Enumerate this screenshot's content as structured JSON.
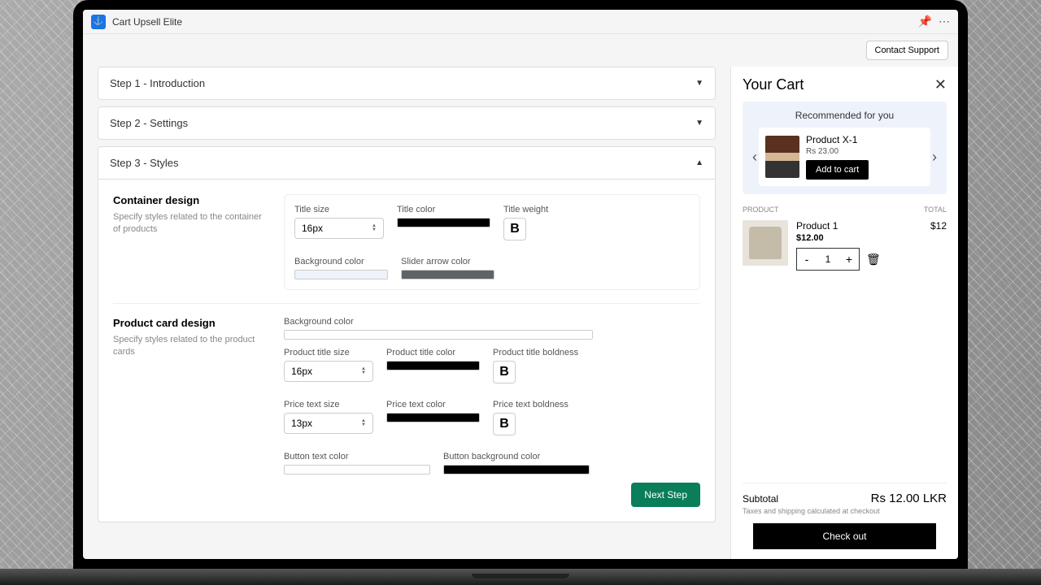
{
  "app": {
    "title": "Cart Upsell Elite"
  },
  "header": {
    "contact_support": "Contact Support"
  },
  "steps": {
    "step1": "Step 1 - Introduction",
    "step2": "Step 2 - Settings",
    "step3": "Step 3 - Styles"
  },
  "container_design": {
    "title": "Container design",
    "desc": "Specify styles related to the container of products",
    "title_size_label": "Title size",
    "title_size_value": "16px",
    "title_color_label": "Title color",
    "title_color": "#000000",
    "title_weight_label": "Title weight",
    "background_color_label": "Background color",
    "background_color": "#eef3fb",
    "slider_arrow_label": "Slider arrow color",
    "slider_arrow_color": "#5f6368"
  },
  "product_card": {
    "title": "Product card design",
    "desc": "Specify styles related to the product cards",
    "background_color_label": "Background color",
    "background_color": "#ffffff",
    "product_title_size_label": "Product title size",
    "product_title_size": "16px",
    "product_title_color_label": "Product title color",
    "product_title_color": "#000000",
    "product_title_bold_label": "Product title boldness",
    "price_size_label": "Price text size",
    "price_size": "13px",
    "price_color_label": "Price text color",
    "price_color": "#000000",
    "price_bold_label": "Price text boldness",
    "button_text_color_label": "Button text color",
    "button_text_color": "#ffffff",
    "button_bg_label": "Button background color",
    "button_bg_color": "#000000"
  },
  "next_step": "Next Step",
  "cart": {
    "title": "Your Cart",
    "reco_title": "Recommended for you",
    "reco_product": "Product X-1",
    "reco_price": "Rs 23.00",
    "add_to_cart": "Add to cart",
    "col_product": "PRODUCT",
    "col_total": "TOTAL",
    "item_name": "Product 1",
    "item_price": "$12.00",
    "item_qty": "1",
    "item_total": "$12",
    "subtotal_label": "Subtotal",
    "subtotal_amount": "Rs 12.00 LKR",
    "tax_note": "Taxes and shipping calculated at checkout",
    "checkout": "Check out"
  }
}
